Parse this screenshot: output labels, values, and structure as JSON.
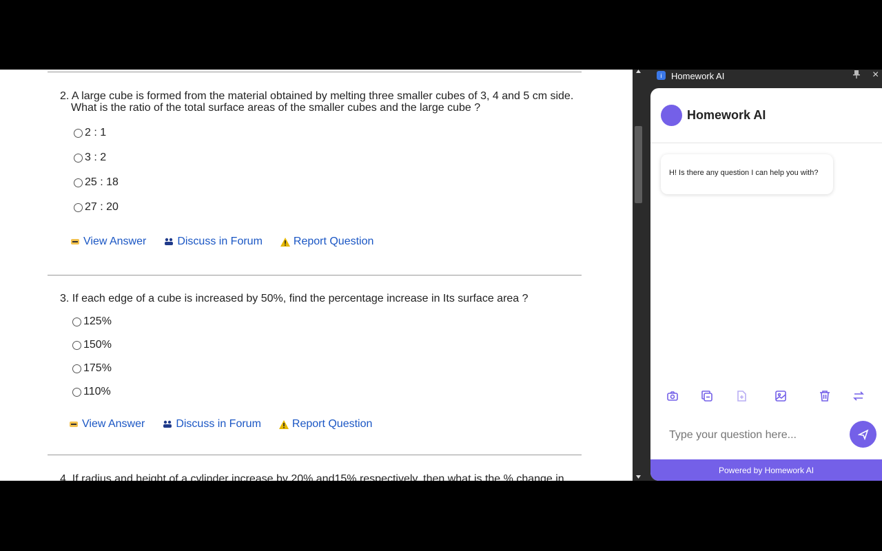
{
  "questions": [
    {
      "number": "2.",
      "line1": "A large cube is formed from the material obtained by melting three smaller cubes of 3, 4 and 5 cm side.",
      "line2": "What is the ratio of the total surface areas of the smaller cubes and the large cube ?",
      "options": [
        "2 : 1",
        "3 : 2",
        "25 : 18",
        "27 : 20"
      ]
    },
    {
      "number": "3.",
      "line1": "If each edge of a cube is increased by 50%, find the percentage increase in Its surface area ?",
      "options": [
        "125%",
        "150%",
        "175%",
        "110%"
      ]
    },
    {
      "number": "4.",
      "line1": "If radius and height of a cylinder increase by 20% and15% respectively, then what is the % change in"
    }
  ],
  "actions": {
    "view_answer": "View Answer",
    "discuss": "Discuss in Forum",
    "report": "Report Question"
  },
  "panel": {
    "window_title": "Homework AI",
    "title": "Homework AI",
    "greeting": "H! Is there any question I can help you with?",
    "input_placeholder": "Type your question here...",
    "footer": "Powered by Homework AI",
    "accent": "#7460e8",
    "tools": [
      "camera-icon",
      "copy-icon",
      "add-file-icon",
      "image-icon",
      "trash-icon",
      "swap-icon"
    ]
  },
  "colors": {
    "link": "#1a56c4",
    "warning": "#e6b800"
  }
}
